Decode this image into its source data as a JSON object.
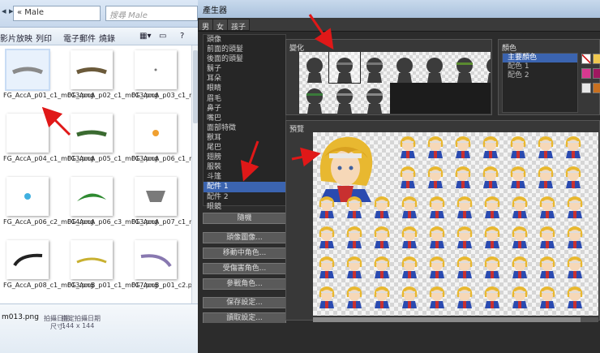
{
  "explorer": {
    "nav": "◂ ▸",
    "path": "« Male",
    "search_placeholder": "搜尋 Male",
    "toolbar": {
      "slideshow": "影片放映",
      "print": "列印",
      "email": "電子郵件",
      "burn": "燒錄"
    },
    "files": [
      {
        "name": "FG_AccA_p01_c1_m013.png",
        "thumb": "bar-gray",
        "selected": true
      },
      {
        "name": "FG_AccA_p02_c1_m013.png",
        "thumb": "bar-dark",
        "selected": false
      },
      {
        "name": "FG_AccA_p03_c1_m013.png",
        "thumb": "dot",
        "selected": false
      },
      {
        "name": "FG_AccA_p04_c1_m013.png",
        "thumb": "blank",
        "selected": false
      },
      {
        "name": "FG_AccA_p05_c1_m013.png",
        "thumb": "bar-green",
        "selected": false
      },
      {
        "name": "FG_AccA_p06_c1_m015.png",
        "thumb": "orange-dot",
        "selected": false
      },
      {
        "name": "FG_AccA_p06_c2_m014.png",
        "thumb": "blue-dot",
        "selected": false
      },
      {
        "name": "FG_AccA_p06_c3_m013.png",
        "thumb": "leaf-green",
        "selected": false
      },
      {
        "name": "FG_AccA_p07_c1_m013.png",
        "thumb": "mask-gray",
        "selected": false
      },
      {
        "name": "FG_AccA_p08_c1_m013.png",
        "thumb": "hook-black",
        "selected": false
      },
      {
        "name": "FG_AccB_p01_c1_m017.png",
        "thumb": "arc-yellow",
        "selected": false
      },
      {
        "name": "FG_AccB_p01_c2.png",
        "thumb": "arc-purple",
        "selected": false
      }
    ],
    "details": {
      "name": "m013.png",
      "date_label": "拍攝日期:",
      "date_value": "指定拍攝日期",
      "size_label": "尺寸:",
      "size_value": "144 x 144"
    }
  },
  "generator": {
    "title": "產生器",
    "tabs": [
      "男",
      "女",
      "孩子"
    ],
    "parts": [
      "頭像",
      "前面的頭髮",
      "後面的頭髮",
      "鬍子",
      "耳朵",
      "眼睛",
      "眉毛",
      "鼻子",
      "嘴巴",
      "面部特徵",
      "獸耳",
      "尾巴",
      "翅膀",
      "服裝",
      "斗篷",
      "配件 1",
      "配件 2",
      "眼鏡"
    ],
    "selected_part_index": 15,
    "buttons": {
      "random": "隨機",
      "save_face": "頭像圖像...",
      "save_walk": "移動中角色...",
      "save_damage": "受傷害角色...",
      "save_battle": "參戰角色...",
      "save_settings": "保存設定...",
      "load_settings": "讀取設定..."
    },
    "variation_label": "變化",
    "color_label": "顏色",
    "color_items": [
      "主要顏色",
      "配色 1",
      "配色 2"
    ],
    "selected_color_index": 0,
    "swatches": [
      "#e4e4e4",
      "#f0c850",
      "#d83890",
      "#a01860",
      "#e8e8e8",
      "#c87020"
    ],
    "preview_label": "預覽",
    "accent": "#3b64b0"
  }
}
